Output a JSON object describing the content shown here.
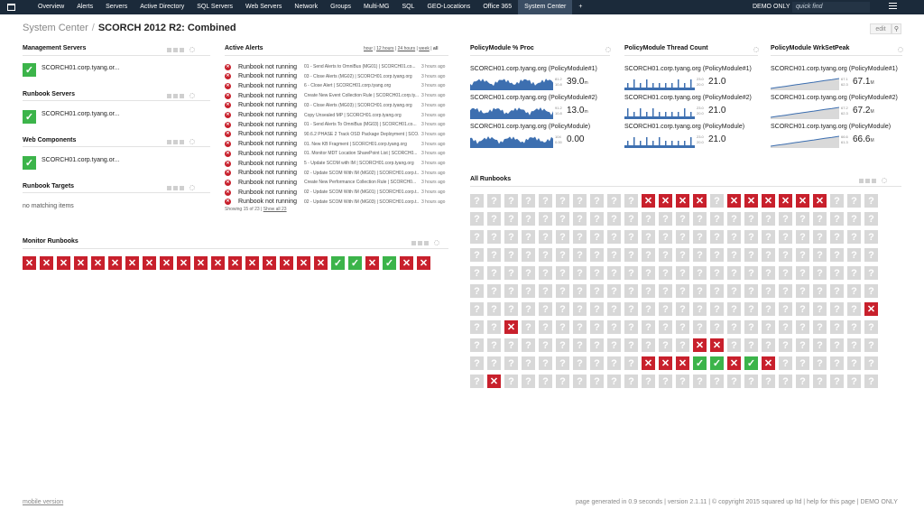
{
  "nav": {
    "items": [
      "Overview",
      "Alerts",
      "Servers",
      "Active Directory",
      "SQL Servers",
      "Web Servers",
      "Network",
      "Groups",
      "Multi-MG",
      "SQL",
      "GEO-Locations",
      "Office 365",
      "System Center",
      "+"
    ],
    "active_index": 12,
    "demo": "DEMO ONLY",
    "search_placeholder": "quick find"
  },
  "breadcrumb": {
    "root": "System Center",
    "sep": "/",
    "current": "SCORCH 2012 R2: Combined"
  },
  "edit_label": "edit",
  "widgets": {
    "mgmt_servers": {
      "title": "Management Servers",
      "items": [
        "SCORCH01.corp.tyang.or..."
      ]
    },
    "runbook_servers": {
      "title": "Runbook Servers",
      "items": [
        "SCORCH01.corp.tyang.or..."
      ]
    },
    "web_components": {
      "title": "Web Components",
      "items": [
        "SCORCH01.corp.tyang.or..."
      ]
    },
    "runbook_targets": {
      "title": "Runbook Targets",
      "empty": "no matching items"
    },
    "monitor_runbooks": {
      "title": "Monitor Runbooks",
      "states": [
        "x",
        "x",
        "x",
        "x",
        "x",
        "x",
        "x",
        "x",
        "x",
        "x",
        "x",
        "x",
        "x",
        "x",
        "x",
        "x",
        "x",
        "x",
        "ok",
        "ok",
        "x",
        "ok",
        "x",
        "x"
      ]
    },
    "active_alerts": {
      "title": "Active Alerts",
      "filters": [
        "hour",
        "12 hours",
        "24 hours",
        "week",
        "all"
      ],
      "rows": [
        {
          "msg": "Runbook not running",
          "desc": "01 - Send Alerts to OmniBus (MG01) | SCORCH01.co...",
          "time": "3 hours ago"
        },
        {
          "msg": "Runbook not running",
          "desc": "03 - Close Alerts (MG02) | SCORCH01.corp.tyang.org",
          "time": "3 hours ago"
        },
        {
          "msg": "Runbook not running",
          "desc": "6 - Close Alert | SCORCH01.corp.tyang.org",
          "time": "3 hours ago"
        },
        {
          "msg": "Runbook not running",
          "desc": "Create New Event Collection Rule | SCORCH01.corp.ty...",
          "time": "3 hours ago"
        },
        {
          "msg": "Runbook not running",
          "desc": "03 - Close Alerts (MG03) | SCORCH01.corp.tyang.org",
          "time": "3 hours ago"
        },
        {
          "msg": "Runbook not running",
          "desc": "Copy Unsealed MP | SCORCH01.corp.tyang.org",
          "time": "3 hours ago"
        },
        {
          "msg": "Runbook not running",
          "desc": "01 - Send Alerts To OmniBus (MG03) | SCORCH01.co...",
          "time": "3 hours ago"
        },
        {
          "msg": "Runbook not running",
          "desc": "90.6.2 PHASE 2 Track OSD Package Deployment | SCO...",
          "time": "3 hours ago"
        },
        {
          "msg": "Runbook not running",
          "desc": "01. New KB Fragment | SCORCH01.corp.tyang.org",
          "time": "3 hours ago"
        },
        {
          "msg": "Runbook not running",
          "desc": "01. Monitor MDT Location SharePoint List | SCORCH0...",
          "time": "3 hours ago"
        },
        {
          "msg": "Runbook not running",
          "desc": "5 - Update SCOM with IM | SCORCH01.corp.tyang.org",
          "time": "3 hours ago"
        },
        {
          "msg": "Runbook not running",
          "desc": "02 - Update SCOM With IM (MG02) | SCORCH01.corp.t...",
          "time": "3 hours ago"
        },
        {
          "msg": "Runbook not running",
          "desc": "Create New Performance Collection Rule | SCORCH0...",
          "time": "3 hours ago"
        },
        {
          "msg": "Runbook not running",
          "desc": "02 - Update SCOM With IM (MG01) | SCORCH01.corp.t...",
          "time": "3 hours ago"
        },
        {
          "msg": "Runbook not running",
          "desc": "02 - Update SCOM With IM (MG03) | SCORCH01.corp.t...",
          "time": "3 hours ago"
        }
      ],
      "showing": "Showing 15 of 23",
      "show_all": "Show all 23"
    },
    "perf_proc": {
      "title": "PolicyModule % Proc",
      "rows": [
        {
          "name": "SCORCH01.corp.tyang.org (PolicyModule#1)",
          "value": "39.0",
          "unit": "m",
          "max": "81.2",
          "min": "10.8"
        },
        {
          "name": "SCORCH01.corp.tyang.org (PolicyModule#2)",
          "value": "13.0",
          "unit": "m",
          "max": "91.2",
          "min": "10.8"
        },
        {
          "name": "SCORCH01.corp.tyang.org (PolicyModule)",
          "value": "0.00",
          "unit": "",
          "max": "104",
          "min": "0.00"
        }
      ]
    },
    "perf_threads": {
      "title": "PolicyModule Thread Count",
      "rows": [
        {
          "name": "SCORCH01.corp.tyang.org (PolicyModule#1)",
          "value": "21.0",
          "unit": "",
          "max": "23.0",
          "min": "20.0"
        },
        {
          "name": "SCORCH01.corp.tyang.org (PolicyModule#2)",
          "value": "21.0",
          "unit": "",
          "max": "23.0",
          "min": "20.0"
        },
        {
          "name": "SCORCH01.corp.tyang.org (PolicyModule)",
          "value": "21.0",
          "unit": "",
          "max": "23.0",
          "min": "20.0"
        }
      ]
    },
    "perf_wrkset": {
      "title": "PolicyModule WrkSetPeak",
      "rows": [
        {
          "name": "SCORCH01.corp.tyang.org (PolicyModule#1)",
          "value": "67.1",
          "unit": "M",
          "max": "67.1",
          "min": "62.3"
        },
        {
          "name": "SCORCH01.corp.tyang.org (PolicyModule#2)",
          "value": "67.2",
          "unit": "M",
          "max": "67.2",
          "min": "62.3"
        },
        {
          "name": "SCORCH01.corp.tyang.org (PolicyModule)",
          "value": "66.6",
          "unit": "M",
          "max": "66.6",
          "min": "61.3"
        }
      ]
    },
    "all_runbooks": {
      "title": "All Runbooks",
      "rows": [
        "??????????xxxx?xxxxxx????",
        "????????????????????????",
        "????????????????????????",
        "????????????????????????",
        "????????????????????????",
        "????????????????????????",
        "???????????????????????x",
        "??x?????????????????????",
        "?????????????xx?????????",
        "??????????xxxooxox??????",
        "?x??????????????????????"
      ]
    }
  },
  "footer": {
    "mobile": "mobile version",
    "info": "page generated in 0.9 seconds | version 2.1.11 | © copyright 2015 squared up ltd | help for this page | DEMO ONLY"
  }
}
